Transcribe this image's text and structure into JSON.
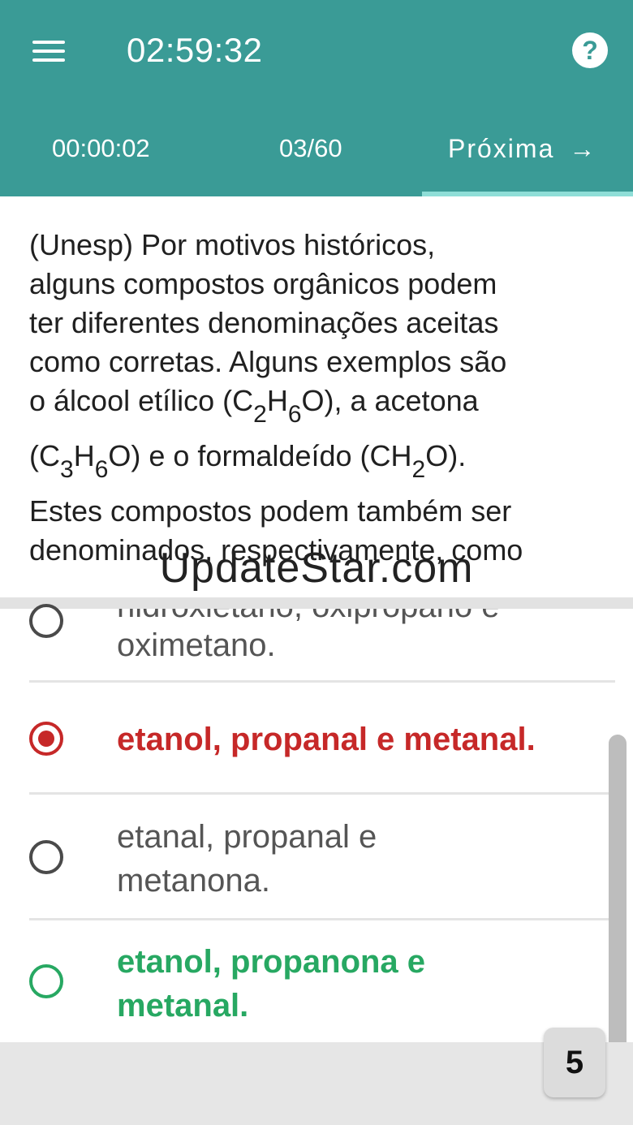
{
  "header": {
    "menu_icon": "hamburger-menu-icon",
    "exam_timer": "02:59:32",
    "help_icon": "question-mark-icon",
    "help_glyph": "?",
    "question_timer": "00:00:02",
    "question_counter": "03/60",
    "next_label": "Próxima",
    "next_arrow": "→"
  },
  "question": {
    "line1": "(Unesp) Por motivos históricos,",
    "line2": "alguns compostos orgânicos podem",
    "line3": "ter diferentes denominações aceitas",
    "line4": "como corretas. Alguns exemplos são",
    "l5_a": "o álcool etílico (C",
    "l5_s1": "2",
    "l5_b": "H",
    "l5_s2": "6",
    "l5_c": "O), a acetona",
    "l6_a": "(C",
    "l6_s1": "3",
    "l6_b": "H",
    "l6_s2": "6",
    "l6_c": "O) e o formaldeído (CH",
    "l6_s3": "2",
    "l6_d": "O).",
    "line7": "Estes compostos podem também ser",
    "line8": "denominados, respectivamente, como"
  },
  "watermark": "UpdateStar.com",
  "options": [
    {
      "text_top_partial": "hidroxietano, oxipropano e",
      "text": "oximetano.",
      "state": "unselected"
    },
    {
      "text": "etanol, propanal e metanal.",
      "state": "selected-wrong"
    },
    {
      "text_line1": "etanal, propanal e",
      "text_line2": "metanona.",
      "state": "unselected"
    },
    {
      "text_line1": "etanol, propanona e",
      "text_line2": "metanal.",
      "state": "correct"
    }
  ],
  "footer": {
    "count": "5"
  },
  "colors": {
    "header_bg": "#3a9b96",
    "wrong": "#c62828",
    "correct": "#27a862",
    "next_underline": "#8fded7"
  }
}
